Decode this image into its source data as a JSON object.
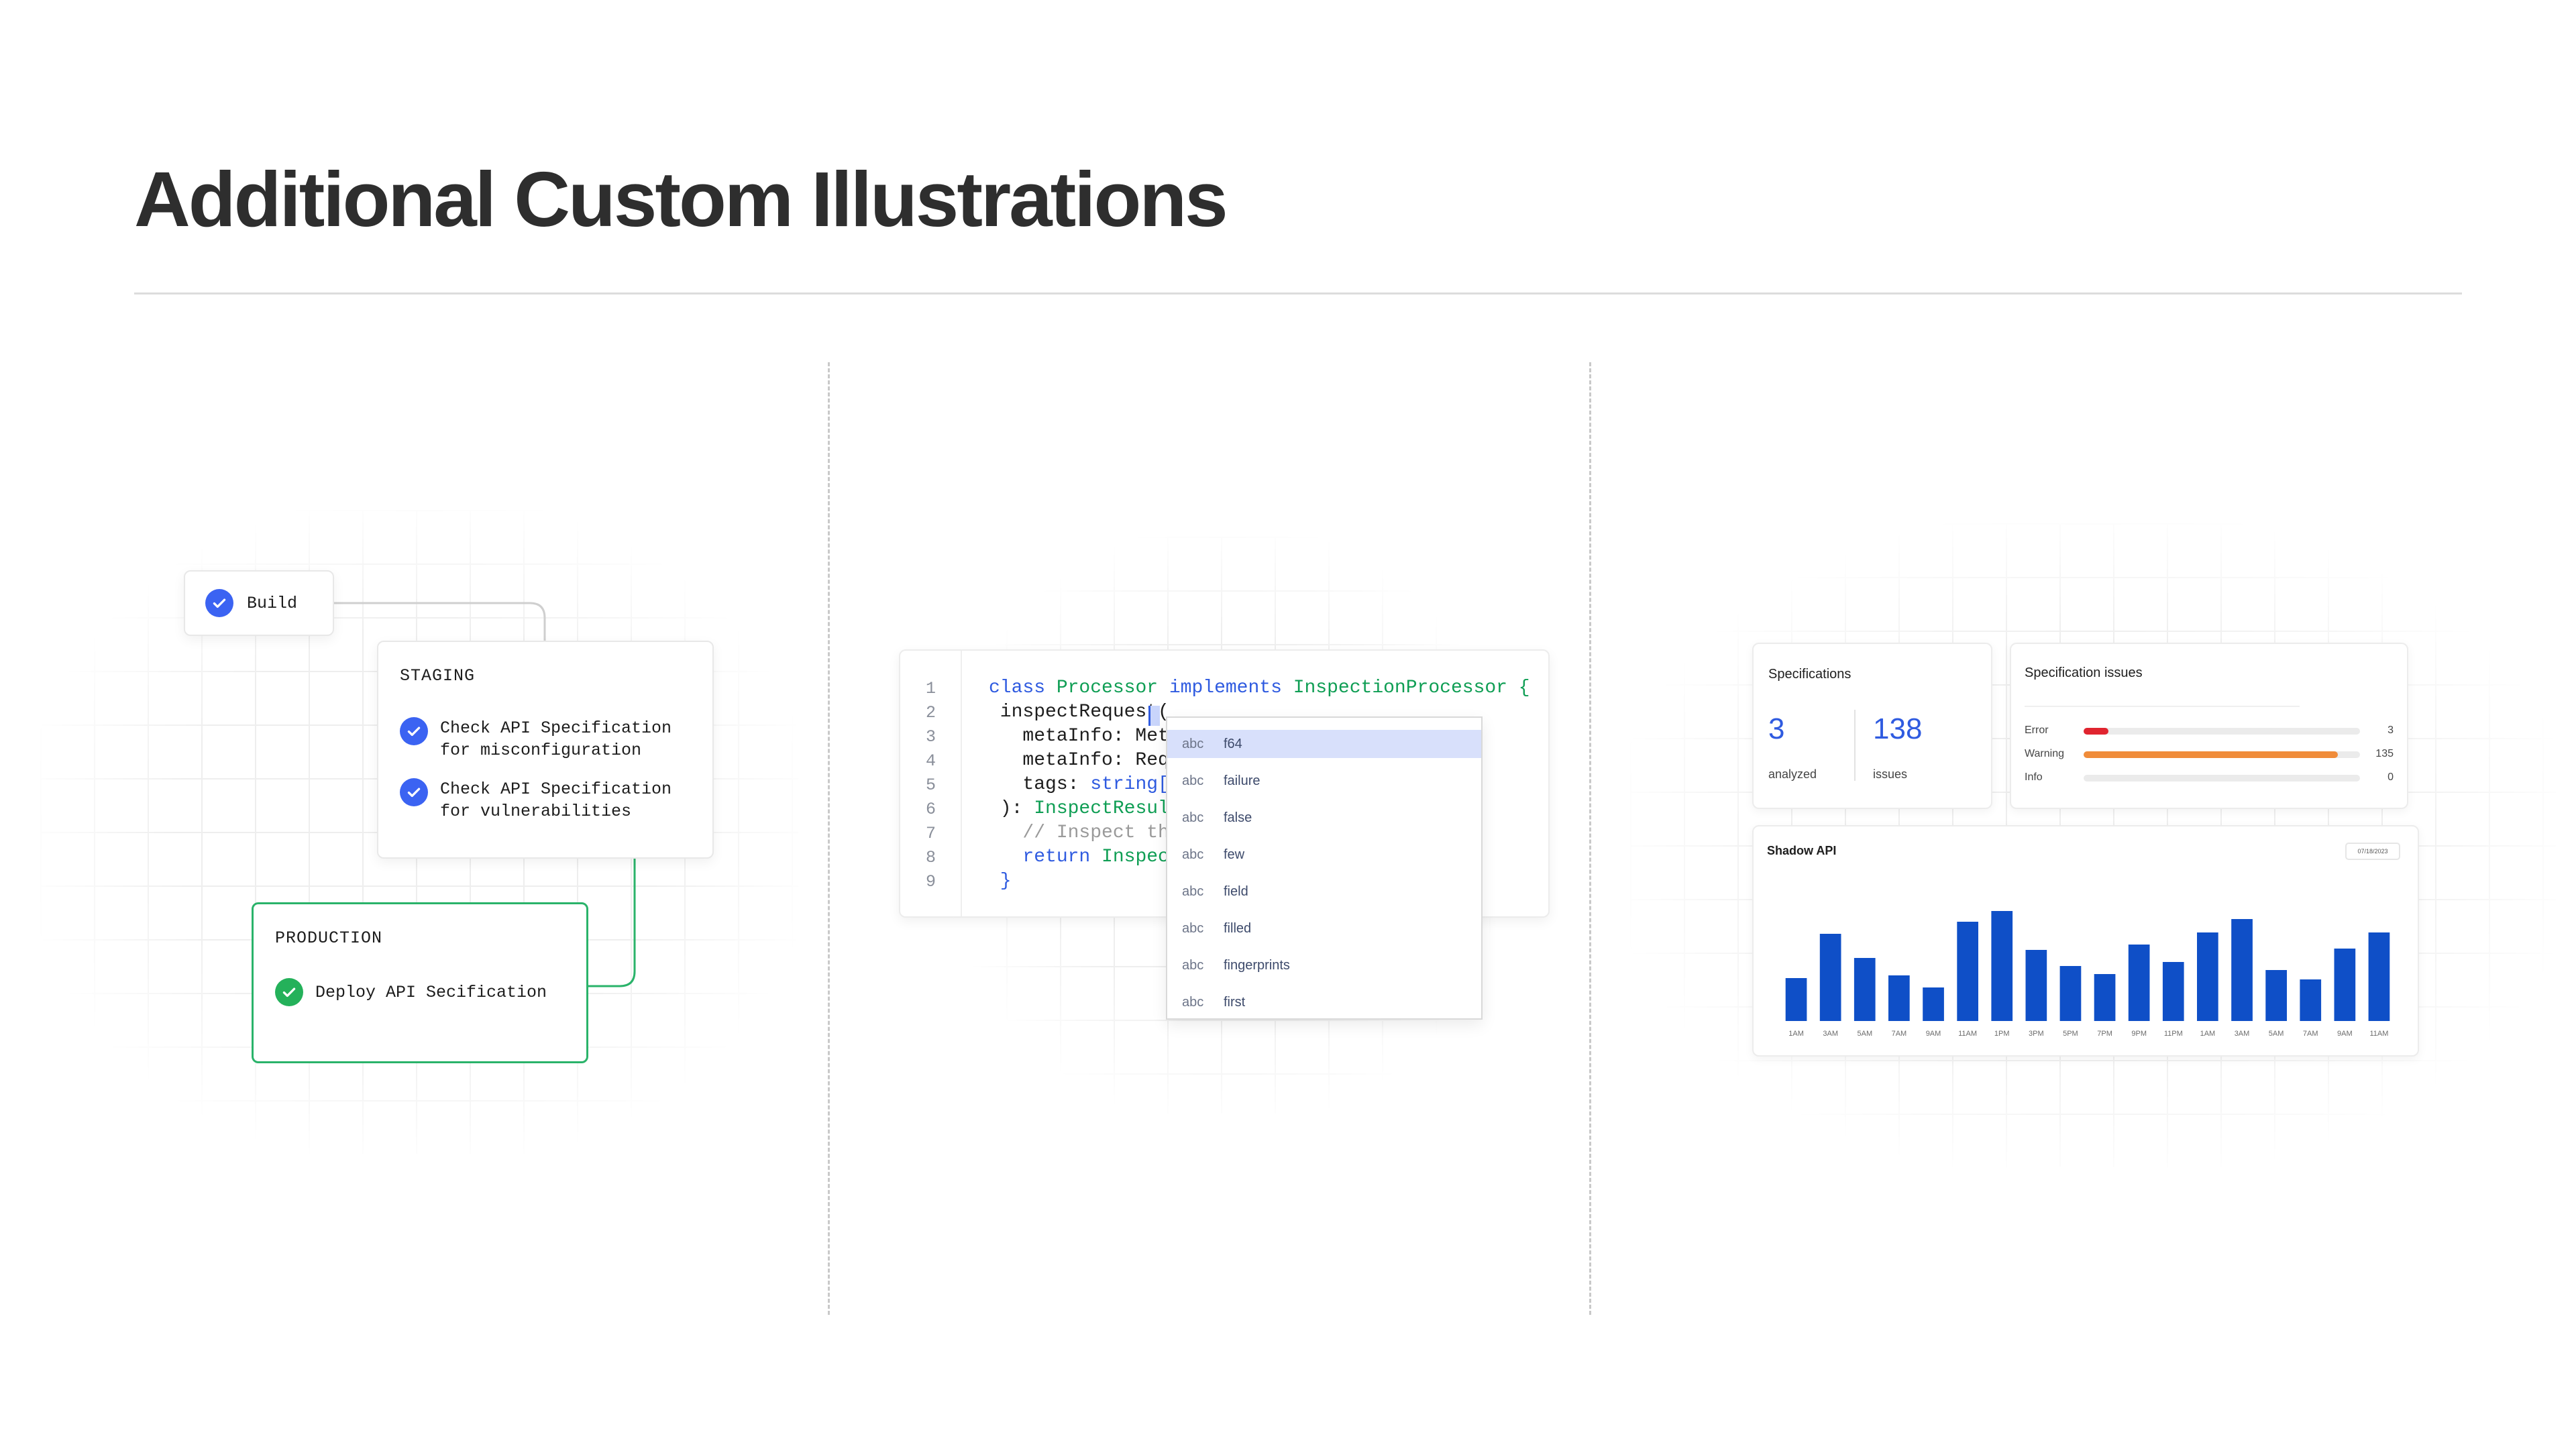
{
  "page": {
    "title": "Additional Custom Illustrations"
  },
  "pipeline": {
    "build": {
      "label": "Build"
    },
    "staging": {
      "title": "STAGING",
      "tasks": [
        {
          "line1": "Check API Specification",
          "line2": "for misconfiguration"
        },
        {
          "line1": "Check API Specification",
          "line2": "for vulnerabilities"
        }
      ]
    },
    "production": {
      "title": "PRODUCTION",
      "task": "Deploy API Secification"
    },
    "colors": {
      "blue": "#3b63f2",
      "green": "#24b15a"
    }
  },
  "editor": {
    "line_numbers": [
      "1",
      "2",
      "3",
      "4",
      "5",
      "6",
      "7",
      "8",
      "9"
    ],
    "lines": [
      {
        "a": "class ",
        "b": "Processor ",
        "c": "implements ",
        "d": "InspectionProcessor {"
      },
      {
        "text": " inspectRequest("
      },
      {
        "text": "   metaInfo: Meta"
      },
      {
        "text": "   metaInfo: Requ"
      },
      {
        "a": "   tags: ",
        "b": "string[]"
      },
      {
        "a": " ): ",
        "b": "InspectResult"
      },
      {
        "text": "   // Inspect the"
      },
      {
        "a": "   return ",
        "b": "Inspect"
      },
      {
        "text": " }"
      }
    ],
    "autocomplete": [
      {
        "type": "abc",
        "label": "f64"
      },
      {
        "type": "abc",
        "label": "failure"
      },
      {
        "type": "abc",
        "label": "false"
      },
      {
        "type": "abc",
        "label": "few"
      },
      {
        "type": "abc",
        "label": "field"
      },
      {
        "type": "abc",
        "label": "filled"
      },
      {
        "type": "abc",
        "label": "fingerprints"
      },
      {
        "type": "abc",
        "label": "first"
      }
    ]
  },
  "dashboard": {
    "specifications": {
      "title": "Specifications",
      "analyzed_value": "3",
      "analyzed_label": "analyzed",
      "issues_value": "138",
      "issues_label": "issues"
    },
    "spec_issues": {
      "title": "Specification issues",
      "rows": [
        {
          "label": "Error",
          "value": "3",
          "fraction": 0.09,
          "color": "#e0242f"
        },
        {
          "label": "Warning",
          "value": "135",
          "fraction": 0.92,
          "color": "#f08c3a"
        },
        {
          "label": "Info",
          "value": "0",
          "fraction": 0,
          "color": "#cccccc"
        }
      ]
    },
    "shadow_api": {
      "title": "Shadow API",
      "date": "07/18/2023"
    }
  },
  "chart_data": {
    "type": "bar",
    "title": "Shadow API",
    "categories": [
      "1AM",
      "3AM",
      "5AM",
      "7AM",
      "9AM",
      "11AM",
      "1PM",
      "3PM",
      "5PM",
      "7PM",
      "9PM",
      "11PM",
      "1AM",
      "3AM",
      "5AM",
      "7AM",
      "9AM",
      "11AM"
    ],
    "values": [
      32,
      65,
      47,
      34,
      25,
      74,
      82,
      53,
      41,
      35,
      57,
      44,
      66,
      76,
      38,
      31,
      54,
      66
    ],
    "ylim": [
      0,
      100
    ],
    "color": "#0f4fc7"
  }
}
